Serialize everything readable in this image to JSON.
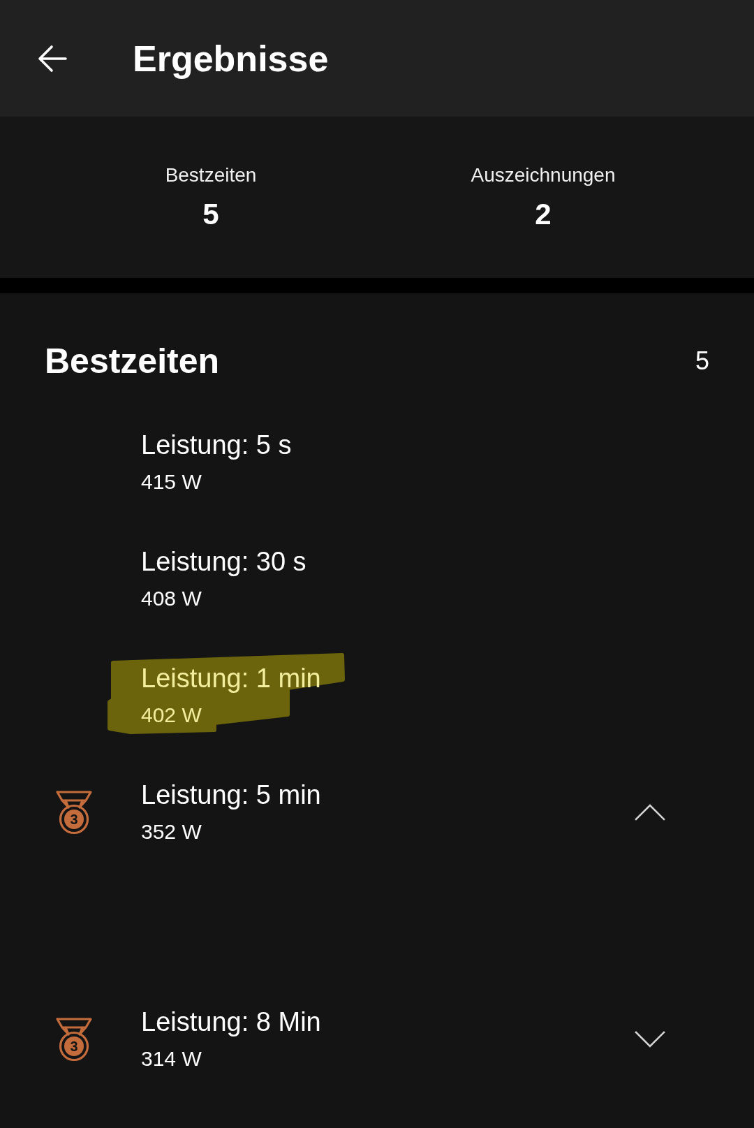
{
  "header": {
    "title": "Ergebnisse"
  },
  "summary": [
    {
      "label": "Bestzeiten",
      "value": "5"
    },
    {
      "label": "Auszeichnungen",
      "value": "2"
    }
  ],
  "best_times": {
    "title": "Bestzeiten",
    "count": "5",
    "items": [
      {
        "kind": "plain",
        "title": "Leistung: 5 s",
        "value": "415 W",
        "highlighted": false
      },
      {
        "kind": "plain",
        "title": "Leistung: 30 s",
        "value": "408 W",
        "highlighted": false
      },
      {
        "kind": "plain",
        "title": "Leistung: 1 min",
        "value": "402 W",
        "highlighted": true
      },
      {
        "kind": "award",
        "medal": "3",
        "title": "Leistung: 5 min",
        "value": "352 W",
        "highlighted": false,
        "expanded": true
      },
      {
        "kind": "award",
        "medal": "3",
        "title": "Leistung: 8 Min",
        "value": "314 W",
        "highlighted": false,
        "expanded": false
      }
    ]
  }
}
